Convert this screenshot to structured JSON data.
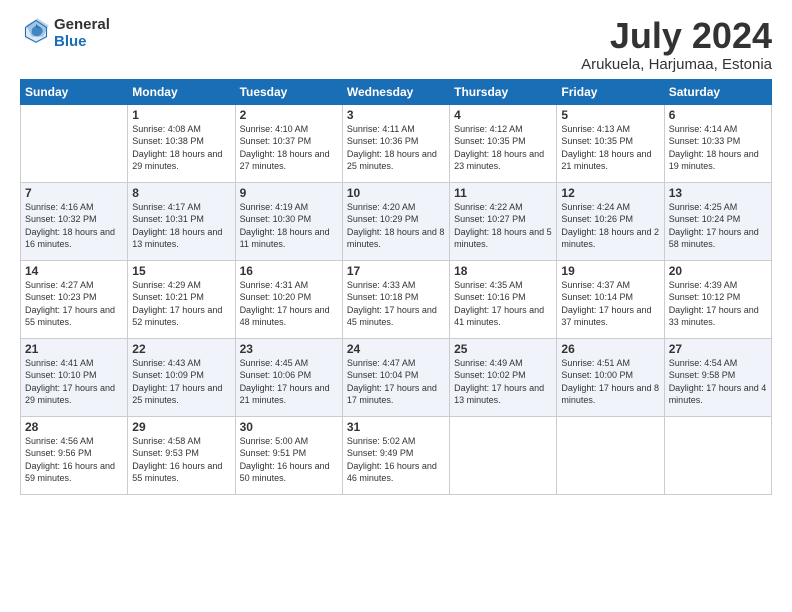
{
  "logo": {
    "general": "General",
    "blue": "Blue"
  },
  "title": "July 2024",
  "subtitle": "Arukuela, Harjumaa, Estonia",
  "header_days": [
    "Sunday",
    "Monday",
    "Tuesday",
    "Wednesday",
    "Thursday",
    "Friday",
    "Saturday"
  ],
  "weeks": [
    [
      {
        "day": "",
        "sunrise": "",
        "sunset": "",
        "daylight": ""
      },
      {
        "day": "1",
        "sunrise": "Sunrise: 4:08 AM",
        "sunset": "Sunset: 10:38 PM",
        "daylight": "Daylight: 18 hours and 29 minutes."
      },
      {
        "day": "2",
        "sunrise": "Sunrise: 4:10 AM",
        "sunset": "Sunset: 10:37 PM",
        "daylight": "Daylight: 18 hours and 27 minutes."
      },
      {
        "day": "3",
        "sunrise": "Sunrise: 4:11 AM",
        "sunset": "Sunset: 10:36 PM",
        "daylight": "Daylight: 18 hours and 25 minutes."
      },
      {
        "day": "4",
        "sunrise": "Sunrise: 4:12 AM",
        "sunset": "Sunset: 10:35 PM",
        "daylight": "Daylight: 18 hours and 23 minutes."
      },
      {
        "day": "5",
        "sunrise": "Sunrise: 4:13 AM",
        "sunset": "Sunset: 10:35 PM",
        "daylight": "Daylight: 18 hours and 21 minutes."
      },
      {
        "day": "6",
        "sunrise": "Sunrise: 4:14 AM",
        "sunset": "Sunset: 10:33 PM",
        "daylight": "Daylight: 18 hours and 19 minutes."
      }
    ],
    [
      {
        "day": "7",
        "sunrise": "Sunrise: 4:16 AM",
        "sunset": "Sunset: 10:32 PM",
        "daylight": "Daylight: 18 hours and 16 minutes."
      },
      {
        "day": "8",
        "sunrise": "Sunrise: 4:17 AM",
        "sunset": "Sunset: 10:31 PM",
        "daylight": "Daylight: 18 hours and 13 minutes."
      },
      {
        "day": "9",
        "sunrise": "Sunrise: 4:19 AM",
        "sunset": "Sunset: 10:30 PM",
        "daylight": "Daylight: 18 hours and 11 minutes."
      },
      {
        "day": "10",
        "sunrise": "Sunrise: 4:20 AM",
        "sunset": "Sunset: 10:29 PM",
        "daylight": "Daylight: 18 hours and 8 minutes."
      },
      {
        "day": "11",
        "sunrise": "Sunrise: 4:22 AM",
        "sunset": "Sunset: 10:27 PM",
        "daylight": "Daylight: 18 hours and 5 minutes."
      },
      {
        "day": "12",
        "sunrise": "Sunrise: 4:24 AM",
        "sunset": "Sunset: 10:26 PM",
        "daylight": "Daylight: 18 hours and 2 minutes."
      },
      {
        "day": "13",
        "sunrise": "Sunrise: 4:25 AM",
        "sunset": "Sunset: 10:24 PM",
        "daylight": "Daylight: 17 hours and 58 minutes."
      }
    ],
    [
      {
        "day": "14",
        "sunrise": "Sunrise: 4:27 AM",
        "sunset": "Sunset: 10:23 PM",
        "daylight": "Daylight: 17 hours and 55 minutes."
      },
      {
        "day": "15",
        "sunrise": "Sunrise: 4:29 AM",
        "sunset": "Sunset: 10:21 PM",
        "daylight": "Daylight: 17 hours and 52 minutes."
      },
      {
        "day": "16",
        "sunrise": "Sunrise: 4:31 AM",
        "sunset": "Sunset: 10:20 PM",
        "daylight": "Daylight: 17 hours and 48 minutes."
      },
      {
        "day": "17",
        "sunrise": "Sunrise: 4:33 AM",
        "sunset": "Sunset: 10:18 PM",
        "daylight": "Daylight: 17 hours and 45 minutes."
      },
      {
        "day": "18",
        "sunrise": "Sunrise: 4:35 AM",
        "sunset": "Sunset: 10:16 PM",
        "daylight": "Daylight: 17 hours and 41 minutes."
      },
      {
        "day": "19",
        "sunrise": "Sunrise: 4:37 AM",
        "sunset": "Sunset: 10:14 PM",
        "daylight": "Daylight: 17 hours and 37 minutes."
      },
      {
        "day": "20",
        "sunrise": "Sunrise: 4:39 AM",
        "sunset": "Sunset: 10:12 PM",
        "daylight": "Daylight: 17 hours and 33 minutes."
      }
    ],
    [
      {
        "day": "21",
        "sunrise": "Sunrise: 4:41 AM",
        "sunset": "Sunset: 10:10 PM",
        "daylight": "Daylight: 17 hours and 29 minutes."
      },
      {
        "day": "22",
        "sunrise": "Sunrise: 4:43 AM",
        "sunset": "Sunset: 10:09 PM",
        "daylight": "Daylight: 17 hours and 25 minutes."
      },
      {
        "day": "23",
        "sunrise": "Sunrise: 4:45 AM",
        "sunset": "Sunset: 10:06 PM",
        "daylight": "Daylight: 17 hours and 21 minutes."
      },
      {
        "day": "24",
        "sunrise": "Sunrise: 4:47 AM",
        "sunset": "Sunset: 10:04 PM",
        "daylight": "Daylight: 17 hours and 17 minutes."
      },
      {
        "day": "25",
        "sunrise": "Sunrise: 4:49 AM",
        "sunset": "Sunset: 10:02 PM",
        "daylight": "Daylight: 17 hours and 13 minutes."
      },
      {
        "day": "26",
        "sunrise": "Sunrise: 4:51 AM",
        "sunset": "Sunset: 10:00 PM",
        "daylight": "Daylight: 17 hours and 8 minutes."
      },
      {
        "day": "27",
        "sunrise": "Sunrise: 4:54 AM",
        "sunset": "Sunset: 9:58 PM",
        "daylight": "Daylight: 17 hours and 4 minutes."
      }
    ],
    [
      {
        "day": "28",
        "sunrise": "Sunrise: 4:56 AM",
        "sunset": "Sunset: 9:56 PM",
        "daylight": "Daylight: 16 hours and 59 minutes."
      },
      {
        "day": "29",
        "sunrise": "Sunrise: 4:58 AM",
        "sunset": "Sunset: 9:53 PM",
        "daylight": "Daylight: 16 hours and 55 minutes."
      },
      {
        "day": "30",
        "sunrise": "Sunrise: 5:00 AM",
        "sunset": "Sunset: 9:51 PM",
        "daylight": "Daylight: 16 hours and 50 minutes."
      },
      {
        "day": "31",
        "sunrise": "Sunrise: 5:02 AM",
        "sunset": "Sunset: 9:49 PM",
        "daylight": "Daylight: 16 hours and 46 minutes."
      },
      {
        "day": "",
        "sunrise": "",
        "sunset": "",
        "daylight": ""
      },
      {
        "day": "",
        "sunrise": "",
        "sunset": "",
        "daylight": ""
      },
      {
        "day": "",
        "sunrise": "",
        "sunset": "",
        "daylight": ""
      }
    ]
  ]
}
